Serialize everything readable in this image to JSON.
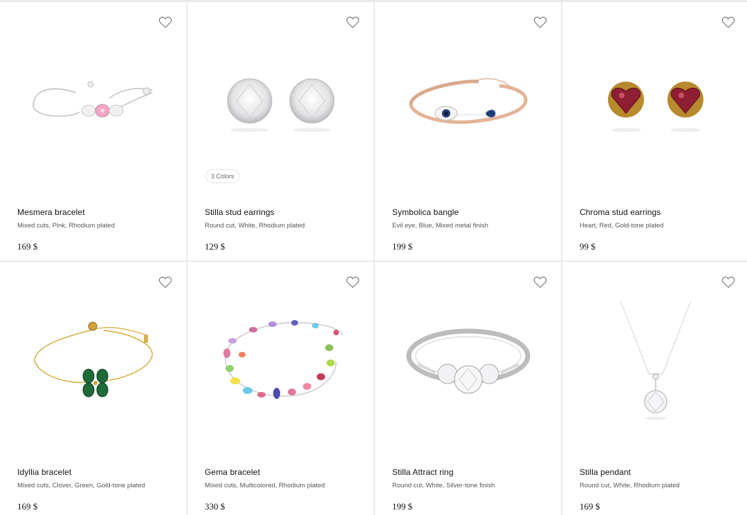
{
  "products": [
    {
      "name": "Mesmera bracelet",
      "desc": "Mixed cuts, Pink, Rhodium plated",
      "price": "169 $",
      "badge": ""
    },
    {
      "name": "Stilla stud earrings",
      "desc": "Round cut, White, Rhodium plated",
      "price": "129 $",
      "badge": "3 Colors"
    },
    {
      "name": "Symbolica bangle",
      "desc": "Evil eye, Blue, Mixed metal finish",
      "price": "199 $",
      "badge": ""
    },
    {
      "name": "Chroma stud earrings",
      "desc": "Heart, Red, Gold-tone plated",
      "price": "99 $",
      "badge": ""
    },
    {
      "name": "Idyllia bracelet",
      "desc": "Mixed cuts, Clover, Green, Gold-tone plated",
      "price": "169 $",
      "badge": ""
    },
    {
      "name": "Gema bracelet",
      "desc": "Mixed cuts, Multicolored, Rhodium plated",
      "price": "330 $",
      "badge": ""
    },
    {
      "name": "Stilla Attract ring",
      "desc": "Round cut, White, Silver-tone finish",
      "price": "199 $",
      "badge": ""
    },
    {
      "name": "Stilla pendant",
      "desc": "Round cut, White, Rhodium plated",
      "price": "169 $",
      "badge": ""
    }
  ],
  "icons": {
    "favorite": "heart-outline-icon"
  },
  "colors": {
    "background": "#ffffff",
    "divider": "#ece9e6",
    "text": "#111111",
    "subtext": "#555555"
  }
}
